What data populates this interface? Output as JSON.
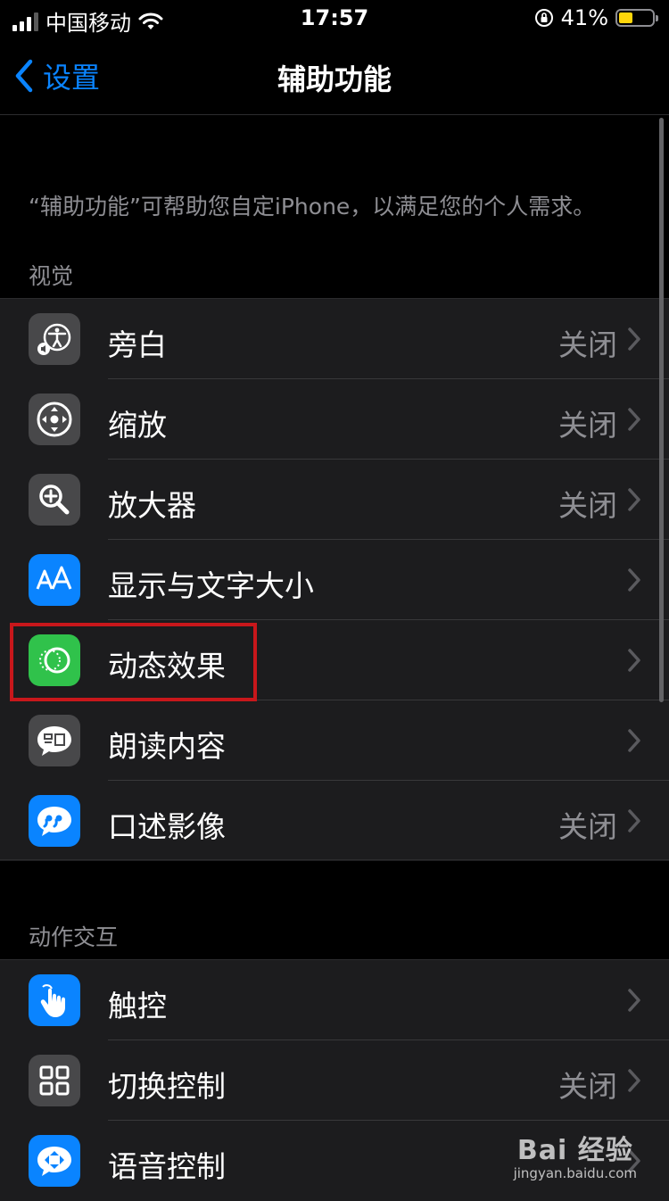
{
  "status_bar": {
    "carrier": "中国移动",
    "time": "17:57",
    "battery_percent": "41%",
    "battery_level": 0.41,
    "battery_color": "#ffd60a"
  },
  "nav": {
    "back_label": "设置",
    "title": "辅助功能"
  },
  "description": "“辅助功能”可帮助您自定iPhone，以满足您的个人需求。",
  "sections": [
    {
      "header": "视觉",
      "items": [
        {
          "label": "旁白",
          "value": "关闭",
          "icon": "voiceover-icon"
        },
        {
          "label": "缩放",
          "value": "关闭",
          "icon": "zoom-icon"
        },
        {
          "label": "放大器",
          "value": "关闭",
          "icon": "magnifier-icon"
        },
        {
          "label": "显示与文字大小",
          "value": "",
          "icon": "text-size-icon"
        },
        {
          "label": "动态效果",
          "value": "",
          "icon": "motion-icon"
        },
        {
          "label": "朗读内容",
          "value": "",
          "icon": "spoken-content-icon"
        },
        {
          "label": "口述影像",
          "value": "关闭",
          "icon": "audio-description-icon"
        }
      ]
    },
    {
      "header": "动作交互",
      "items": [
        {
          "label": "触控",
          "value": "",
          "icon": "touch-icon"
        },
        {
          "label": "切换控制",
          "value": "关闭",
          "icon": "switch-control-icon"
        },
        {
          "label": "语音控制",
          "value": "",
          "icon": "voice-control-icon"
        }
      ]
    }
  ],
  "accent_color": "#0a84ff",
  "highlight_color": "#c8171b",
  "watermark": {
    "brand": "Bai 经验",
    "url": "jingyan.baidu.com"
  }
}
